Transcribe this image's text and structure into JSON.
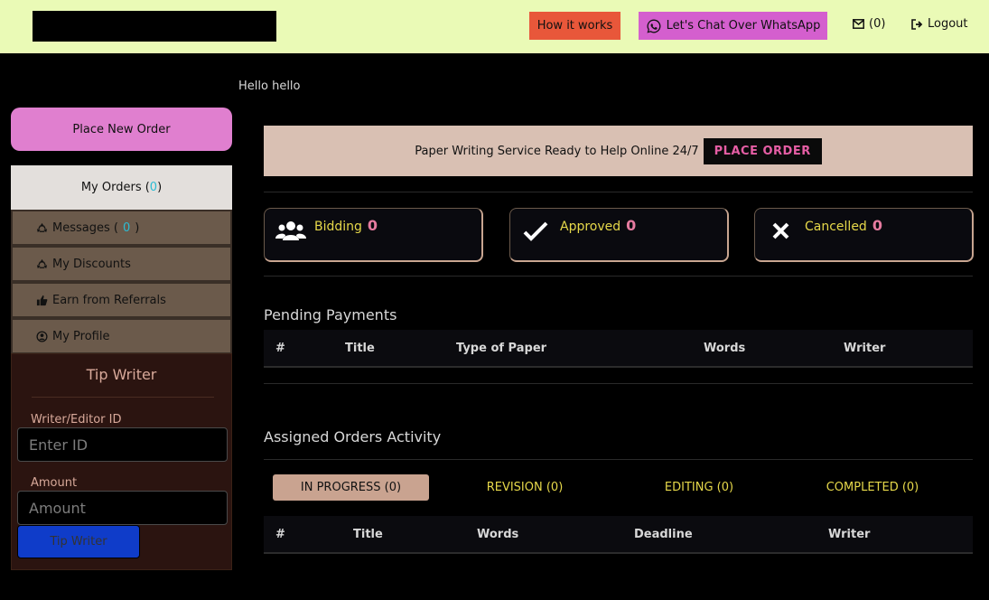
{
  "header": {
    "how_it_works": "How it works",
    "whatsapp": "Let's Chat Over WhatsApp",
    "mail_count": "(0)",
    "logout": "Logout"
  },
  "greeting": "Hello hello",
  "sidebar": {
    "place_new_order": "Place New Order",
    "my_orders_label": "My Orders (",
    "my_orders_count": "0",
    "my_orders_close": " )",
    "items": [
      {
        "label": "Messages (",
        "count": "0",
        "close": " )"
      },
      {
        "label": "My Discounts"
      },
      {
        "label": "Earn from Referrals"
      },
      {
        "label": "My Profile"
      }
    ]
  },
  "tip": {
    "title": "Tip Writer",
    "id_label": "Writer/Editor ID",
    "id_placeholder": "Enter ID",
    "amount_label": "Amount",
    "amount_placeholder": "Amount",
    "button": "Tip Writer"
  },
  "banner": {
    "text": "Paper Writing Service Ready to Help Online 24/7",
    "button": "PLACE ORDER"
  },
  "stats": [
    {
      "label": "Bidding",
      "count": "0",
      "icon": "users-icon"
    },
    {
      "label": "Approved",
      "count": "0",
      "icon": "check-icon"
    },
    {
      "label": "Cancelled",
      "count": "0",
      "icon": "close-icon"
    }
  ],
  "pending": {
    "title": "Pending Payments",
    "columns": [
      "#",
      "Title",
      "Type of Paper",
      "Words",
      "Writer"
    ]
  },
  "assigned": {
    "title": "Assigned Orders Activity",
    "tabs": [
      "IN PROGRESS (0)",
      "REVISION (0)",
      "EDITING (0)",
      "COMPLETED (0)"
    ],
    "columns": [
      "#",
      "Title",
      "Words",
      "Deadline",
      "Writer"
    ]
  },
  "colors": {
    "topbar": "#eafab6",
    "how_btn": "#e8573a",
    "whatsapp_btn": "#d45fce",
    "place_new": "#e07fcf",
    "banner": "#d9c0b3",
    "accent_pink": "#e65ea5",
    "stat_label": "#e6d84a"
  }
}
